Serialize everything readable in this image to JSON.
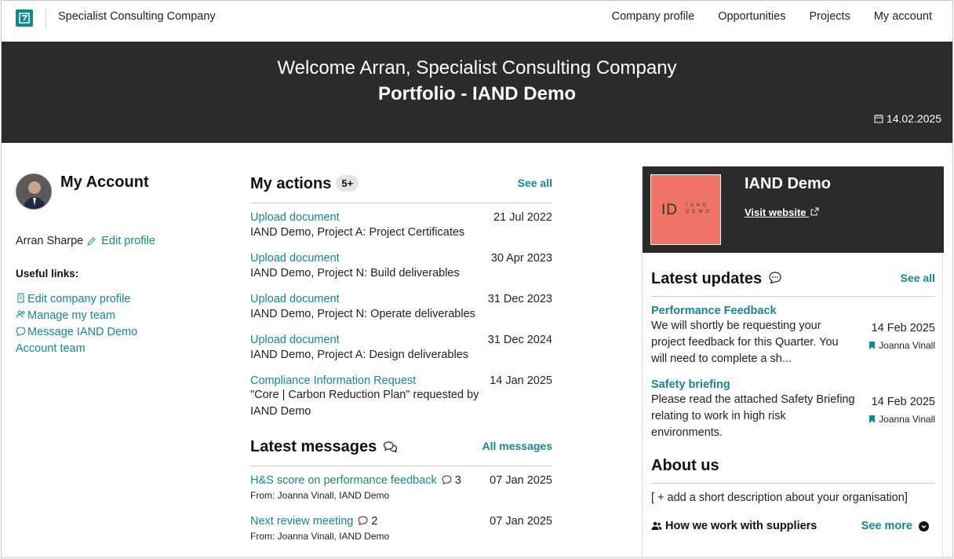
{
  "header": {
    "company_name": "Specialist Consulting Company",
    "nav": [
      "Company profile",
      "Opportunities",
      "Projects",
      "My account"
    ]
  },
  "banner": {
    "welcome": "Welcome Arran, Specialist Consulting Company",
    "portfolio": "Portfolio - IAND Demo",
    "date": "14.02.2025"
  },
  "account": {
    "title": "My Account",
    "user_name": "Arran Sharpe",
    "edit_profile": "Edit profile",
    "useful_links_label": "Useful links:",
    "links": [
      "Edit company profile",
      "Manage my team",
      "Message IAND Demo Account team"
    ]
  },
  "actions": {
    "title": "My actions",
    "badge": "5+",
    "see_all": "See all",
    "items": [
      {
        "title": "Upload document",
        "date": "21 Jul 2022",
        "sub": "IAND Demo, Project A: Project Certificates"
      },
      {
        "title": "Upload document",
        "date": "30 Apr 2023",
        "sub": "IAND Demo, Project N: Build deliverables"
      },
      {
        "title": "Upload document",
        "date": "31 Dec 2023",
        "sub": "IAND Demo, Project N: Operate deliverables"
      },
      {
        "title": "Upload document",
        "date": "31 Dec 2024",
        "sub": "IAND Demo, Project A: Design deliverables"
      },
      {
        "title": "Compliance Information Request",
        "date": "14 Jan 2025",
        "sub": "\"Core | Carbon Reduction Plan\" requested by IAND Demo"
      }
    ]
  },
  "messages": {
    "title": "Latest messages",
    "all_link": "All messages",
    "items": [
      {
        "title": "H&S score on performance feedback",
        "count": "3",
        "date": "07 Jan 2025",
        "from": "From: Joanna Vinall, IAND Demo"
      },
      {
        "title": "Next review meeting",
        "count": "2",
        "date": "07 Jan 2025",
        "from": "From: Joanna Vinall, IAND Demo"
      }
    ]
  },
  "client": {
    "name": "IAND Demo",
    "visit_website": "Visit website",
    "logo_text": "ID",
    "logo_small_1": "IAND",
    "logo_small_2": "DEMO"
  },
  "updates": {
    "title": "Latest updates",
    "see_all": "See all",
    "items": [
      {
        "title": "Performance Feedback",
        "body": "We will shortly be requesting your project feedback for this Quarter. You will need to complete a sh...",
        "date": "14 Feb 2025",
        "author": "Joanna Vinall"
      },
      {
        "title": "Safety briefing",
        "body": "Please read the attached Safety Briefing relating to work in high risk environments.",
        "date": "14 Feb 2025",
        "author": "Joanna Vinall"
      }
    ]
  },
  "about": {
    "title": "About us",
    "placeholder": "[ + add a short description about your organisation]",
    "how_we_work": "How we work with suppliers",
    "see_more": "See more"
  },
  "colors": {
    "accent": "#17878e",
    "banner": "#2b2b2b",
    "client_logo": "#f07466"
  }
}
